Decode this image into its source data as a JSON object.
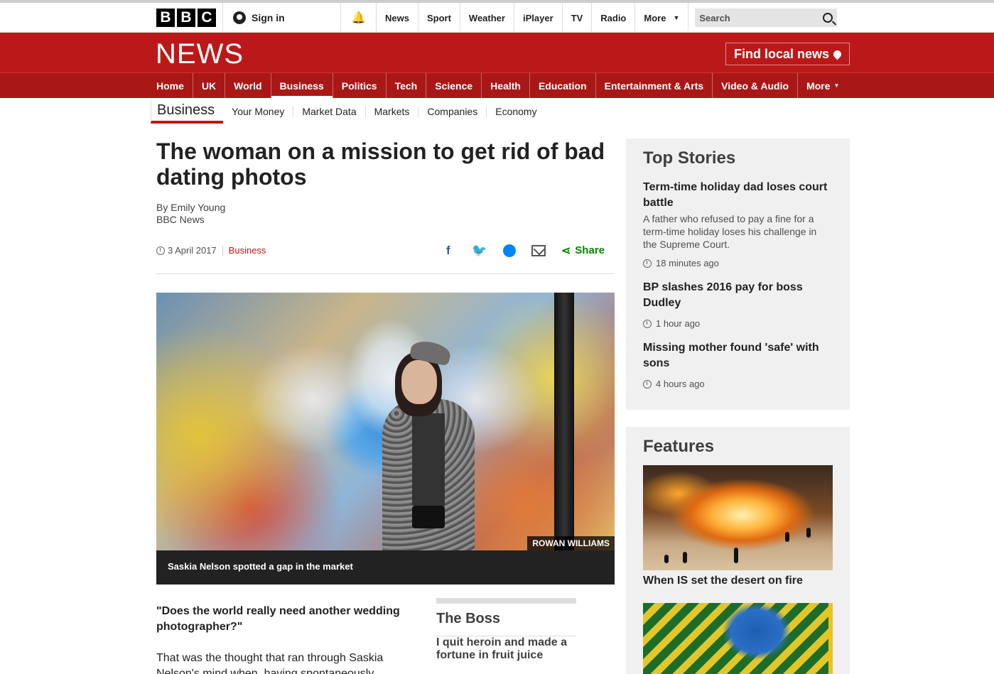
{
  "topbar": {
    "logo_letters": [
      "B",
      "B",
      "C"
    ],
    "signin_label": "Sign in",
    "nav": [
      "News",
      "Sport",
      "Weather",
      "iPlayer",
      "TV",
      "Radio"
    ],
    "more_label": "More",
    "search_placeholder": "Search"
  },
  "masthead": {
    "wordmark": "NEWS",
    "find_local_label": "Find local news",
    "brand_color": "#bb1919"
  },
  "section_nav": {
    "items": [
      "Home",
      "UK",
      "World",
      "Business",
      "Politics",
      "Tech",
      "Science",
      "Health",
      "Education",
      "Entertainment & Arts",
      "Video & Audio"
    ],
    "active": "Business",
    "more_label": "More"
  },
  "sub_nav": {
    "title": "Business",
    "items": [
      "Your Money",
      "Market Data",
      "Markets",
      "Companies",
      "Economy"
    ]
  },
  "article": {
    "headline": "The woman on a mission to get rid of bad dating photos",
    "author": "By Emily Young",
    "outlet": "BBC News",
    "date": "3 April 2017",
    "section": "Business",
    "share_label": "Share",
    "image_credit": "ROWAN WILLIAMS",
    "caption": "Saskia Nelson spotted a gap in the market",
    "lede": "\"Does the world really need another wedding photographer?\"",
    "body_first": "That was the thought that ran through Saskia Nelson's mind when, having spontaneously resigned"
  },
  "series": {
    "title": "The Boss",
    "link": "I quit heroin and made a fortune in fruit juice"
  },
  "top_stories": {
    "title": "Top Stories",
    "items": [
      {
        "title": "Term-time holiday dad loses court battle",
        "summary": "A father who refused to pay a fine for a term-time holiday loses his challenge in the Supreme Court.",
        "time": "18 minutes ago"
      },
      {
        "title": "BP slashes 2016 pay for boss Dudley",
        "summary": "",
        "time": "1 hour ago"
      },
      {
        "title": "Missing mother found 'safe' with sons",
        "summary": "",
        "time": "4 hours ago"
      }
    ]
  },
  "features": {
    "title": "Features",
    "items": [
      {
        "title": "When IS set the desert on fire"
      }
    ]
  },
  "icons": {
    "signin": "user-icon",
    "notifications": "bell-icon",
    "search": "search-icon",
    "location": "map-pin-icon",
    "facebook": "facebook-icon",
    "twitter": "twitter-icon",
    "messenger": "messenger-icon",
    "email": "email-icon",
    "share": "share-icon",
    "clock": "clock-icon"
  }
}
